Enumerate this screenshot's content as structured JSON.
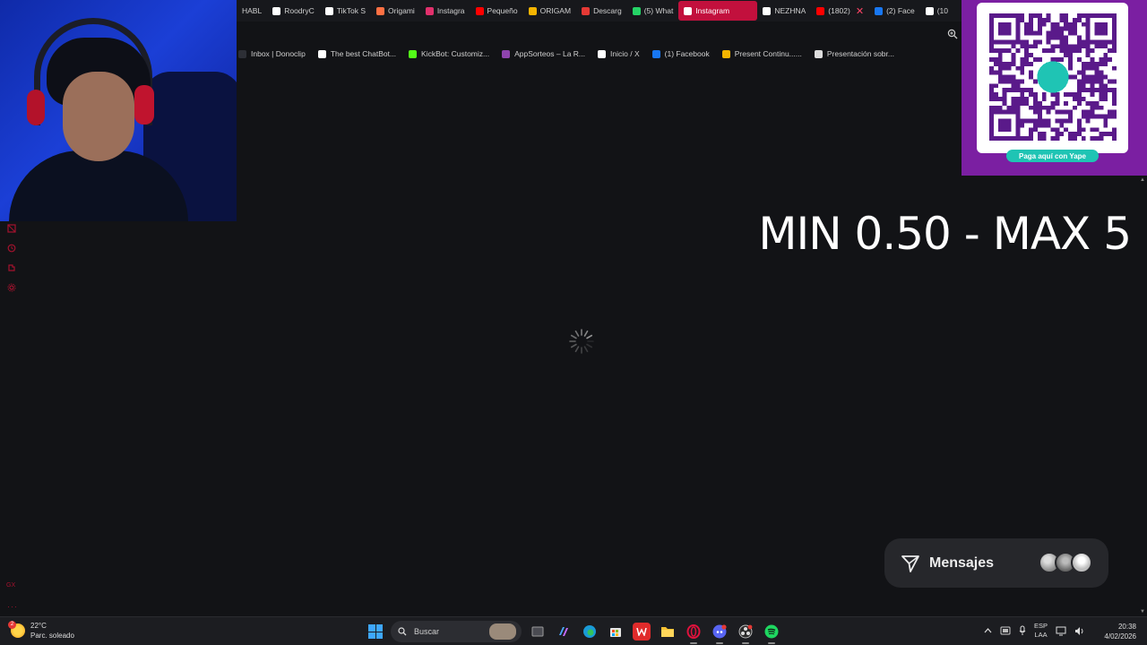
{
  "tabs": [
    {
      "label": "HABL",
      "fav": "#888888"
    },
    {
      "label": "RoodryC",
      "fav": "#ffffff",
      "icon": "tiktok-icon"
    },
    {
      "label": "TikTok S",
      "fav": "#ffffff",
      "icon": "tiktok-icon"
    },
    {
      "label": "Origami",
      "fav": "#ff7043",
      "icon": "origami-icon"
    },
    {
      "label": "Instagra",
      "fav": "#e1306c",
      "icon": "instagram-icon"
    },
    {
      "label": "Pequeño",
      "fav": "#ff0000",
      "icon": "youtube-icon"
    },
    {
      "label": "ORIGAM",
      "fav": "#f4b400",
      "icon": "drive-icon"
    },
    {
      "label": "Descarg",
      "fav": "#e53935",
      "icon": "download-icon"
    },
    {
      "label": "(5) What",
      "fav": "#25d366",
      "icon": "whatsapp-icon"
    },
    {
      "label": "Instagram",
      "fav": "#ffffff",
      "icon": "instagram-icon",
      "active": true
    },
    {
      "label": "NEZHNA",
      "fav": "#ffffff",
      "icon": "notion-icon"
    },
    {
      "label": "(1802)",
      "fav": "#ff0000",
      "icon": "youtube-icon",
      "close": true
    },
    {
      "label": "(2) Face",
      "fav": "#1877f2",
      "icon": "facebook-icon"
    },
    {
      "label": "(10",
      "fav": "#ffffff",
      "icon": "tiktok-icon"
    }
  ],
  "bookmarks": [
    {
      "label": "Inbox | Donoclip",
      "fav": "#2d2f36"
    },
    {
      "label": "The best ChatBot...",
      "fav": "#ffffff"
    },
    {
      "label": "KickBot: Customiz...",
      "fav": "#53fc18"
    },
    {
      "label": "AppSorteos – La R...",
      "fav": "#8e44ad"
    },
    {
      "label": "Inicio / X",
      "fav": "#ffffff"
    },
    {
      "label": "(1) Facebook",
      "fav": "#1877f2"
    },
    {
      "label": "Present Continu......",
      "fav": "#f4b400"
    },
    {
      "label": "Presentación sobr...",
      "fav": "#dddddd"
    }
  ],
  "overlay": {
    "minmax_text": "MIN 0.50 - MAX 5",
    "yape_pill": "Paga aquí con Yape"
  },
  "messages": {
    "label": "Mensajes"
  },
  "sidebar": {
    "bottom_label": "GX",
    "more": "···"
  },
  "taskbar": {
    "temperature": "22°C",
    "weather": "Parc. soleado",
    "weather_badge": "2",
    "search_placeholder": "Buscar",
    "lang_top": "ESP",
    "lang_bottom": "LAA",
    "time": "20:38",
    "date": "4/02/2026"
  },
  "colors": {
    "accent": "#c2103d",
    "yape_purple": "#7b1fa2",
    "yape_teal": "#1fc4b4"
  }
}
